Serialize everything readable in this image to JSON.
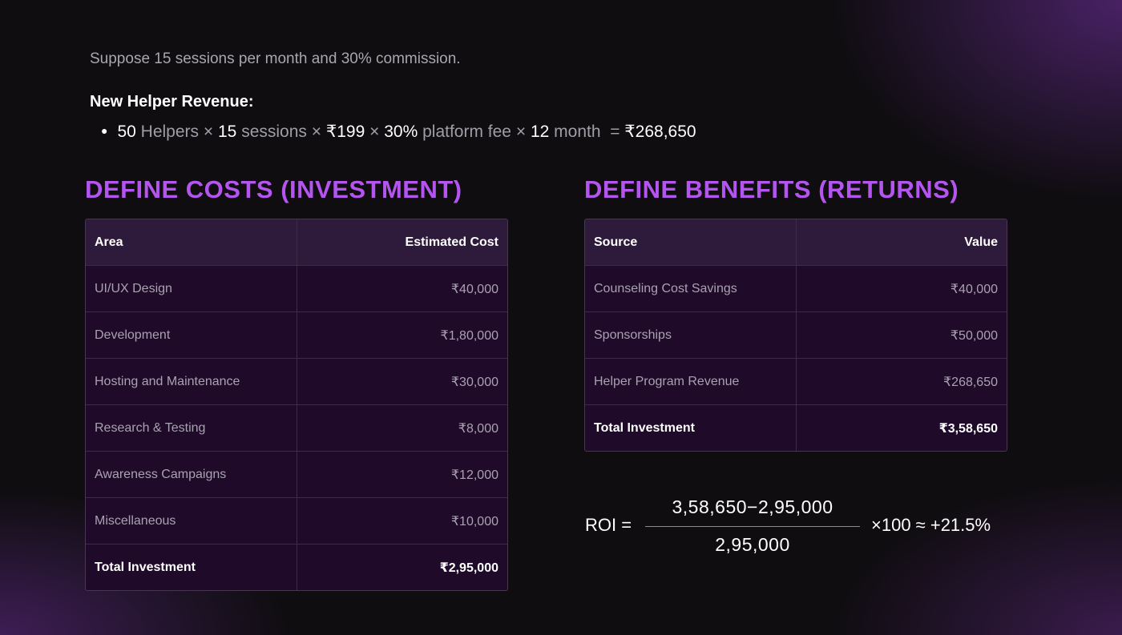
{
  "intro": "Suppose 15 sessions per month and 30% commission.",
  "helper_revenue": {
    "title": "New Helper Revenue:",
    "formula": {
      "helpers_num": "50",
      "helpers_word": "Helpers",
      "sessions_num": "15",
      "sessions_word": "sessions",
      "price": "₹199",
      "fee_num": "30%",
      "fee_word": "platform fee",
      "months_num": "12",
      "months_word": "month",
      "times": "×",
      "equals": "=",
      "result": "₹268,650"
    }
  },
  "costs": {
    "title": "DEFINE COSTS (INVESTMENT)",
    "headers": [
      "Area",
      "Estimated Cost"
    ],
    "rows": [
      [
        "UI/UX Design",
        "₹40,000"
      ],
      [
        "Development",
        "₹1,80,000"
      ],
      [
        "Hosting and Maintenance",
        "₹30,000"
      ],
      [
        "Research & Testing",
        "₹8,000"
      ],
      [
        "Awareness Campaigns",
        "₹12,000"
      ],
      [
        "Miscellaneous",
        "₹10,000"
      ]
    ],
    "total": [
      "Total Investment",
      "₹2,95,000"
    ]
  },
  "benefits": {
    "title": "DEFINE BENEFITS (RETURNS)",
    "headers": [
      "Source",
      "Value"
    ],
    "rows": [
      [
        "Counseling Cost Savings",
        "₹40,000"
      ],
      [
        "Sponsorships",
        "₹50,000"
      ],
      [
        "Helper Program Revenue",
        "₹268,650"
      ]
    ],
    "total": [
      "Total Investment",
      "₹3,58,650"
    ]
  },
  "roi": {
    "label": "ROI =",
    "numerator": "3,58,650−2,95,000",
    "denominator": "2,95,000",
    "result": "×100 ≈ +21.5%"
  },
  "colors": {
    "accent": "#b455f0",
    "table_bg": "#1f0a2a",
    "table_header_bg": "#2e1a3a",
    "page_bg": "#0f0d10"
  }
}
